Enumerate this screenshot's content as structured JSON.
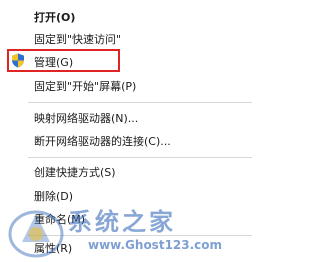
{
  "menu": {
    "items": [
      {
        "label": "打开(O)"
      },
      {
        "label": "固定到\"快速访问\""
      },
      {
        "label": "管理(G)"
      },
      {
        "label": "固定到\"开始\"屏幕(P)"
      },
      {
        "label": "映射网络驱动器(N)..."
      },
      {
        "label": "断开网络驱动器的连接(C)..."
      },
      {
        "label": "创建快捷方式(S)"
      },
      {
        "label": "删除(D)"
      },
      {
        "label": "重命名(M)"
      },
      {
        "label": "属性(R)"
      }
    ]
  },
  "icons": {
    "manage": "uac-shield-icon"
  },
  "colors": {
    "highlight_border": "#e02424",
    "watermark": "#285fb4"
  },
  "watermark": {
    "title": "系统之家",
    "url": "www.Ghost123.com"
  }
}
